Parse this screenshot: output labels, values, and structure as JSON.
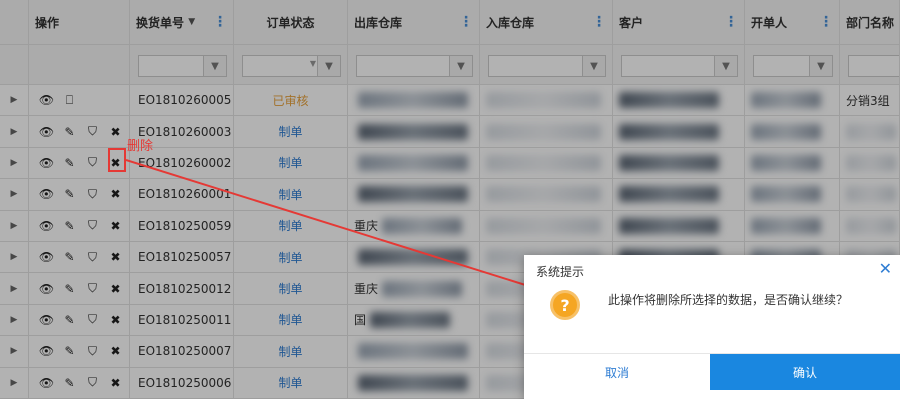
{
  "columns": {
    "ops": "操作",
    "order_no": "换货单号",
    "order_status": "订单状态",
    "out_warehouse": "出库仓库",
    "in_warehouse": "入库仓库",
    "customer": "客户",
    "creator": "开单人",
    "department": "部门名称"
  },
  "rows": [
    {
      "order_no": "EO1810260005",
      "status": "已审核",
      "status_color": "#e8a33d",
      "ops": [
        "eye-icon",
        "copy-icon"
      ],
      "department": "分销3组"
    },
    {
      "order_no": "EO1810260003",
      "status": "制单",
      "status_color": "#2f7dd3",
      "ops": [
        "eye-icon",
        "pencil-icon",
        "shield-icon",
        "close-icon"
      ],
      "department": ""
    },
    {
      "order_no": "EO1810260002",
      "status": "制单",
      "status_color": "#2f7dd3",
      "ops": [
        "eye-icon",
        "pencil-icon",
        "shield-icon",
        "close-icon"
      ],
      "department": ""
    },
    {
      "order_no": "EO1810260001",
      "status": "制单",
      "status_color": "#2f7dd3",
      "ops": [
        "eye-icon",
        "pencil-icon",
        "shield-icon",
        "close-icon"
      ],
      "department": ""
    },
    {
      "order_no": "EO1810250059",
      "status": "制单",
      "status_color": "#2f7dd3",
      "ops": [
        "eye-icon",
        "pencil-icon",
        "shield-icon",
        "close-icon"
      ],
      "department": "",
      "out_warehouse": "重庆"
    },
    {
      "order_no": "EO1810250057",
      "status": "制单",
      "status_color": "#2f7dd3",
      "ops": [
        "eye-icon",
        "pencil-icon",
        "shield-icon",
        "close-icon"
      ],
      "department": ""
    },
    {
      "order_no": "EO1810250012",
      "status": "制单",
      "status_color": "#2f7dd3",
      "ops": [
        "eye-icon",
        "pencil-icon",
        "shield-icon",
        "close-icon"
      ],
      "department": "",
      "out_warehouse": "重庆"
    },
    {
      "order_no": "EO1810250011",
      "status": "制单",
      "status_color": "#2f7dd3",
      "ops": [
        "eye-icon",
        "pencil-icon",
        "shield-icon",
        "close-icon"
      ],
      "department": "",
      "out_warehouse": "国"
    },
    {
      "order_no": "EO1810250007",
      "status": "制单",
      "status_color": "#2f7dd3",
      "ops": [
        "eye-icon",
        "pencil-icon",
        "shield-icon",
        "close-icon"
      ],
      "department": ""
    },
    {
      "order_no": "EO1810250006",
      "status": "制单",
      "status_color": "#2f7dd3",
      "ops": [
        "eye-icon",
        "pencil-icon",
        "shield-icon",
        "close-icon"
      ],
      "department": ""
    }
  ],
  "dialog": {
    "title": "系统提示",
    "message": "此操作将删除所选择的数据，是否确认继续？",
    "cancel_label": "取消",
    "confirm_label": "确认",
    "close_icon": "close-icon",
    "icon": "question-icon",
    "confirm_color": "#1a87e0"
  },
  "annotation": {
    "label": "删除",
    "color": "#e53935"
  }
}
